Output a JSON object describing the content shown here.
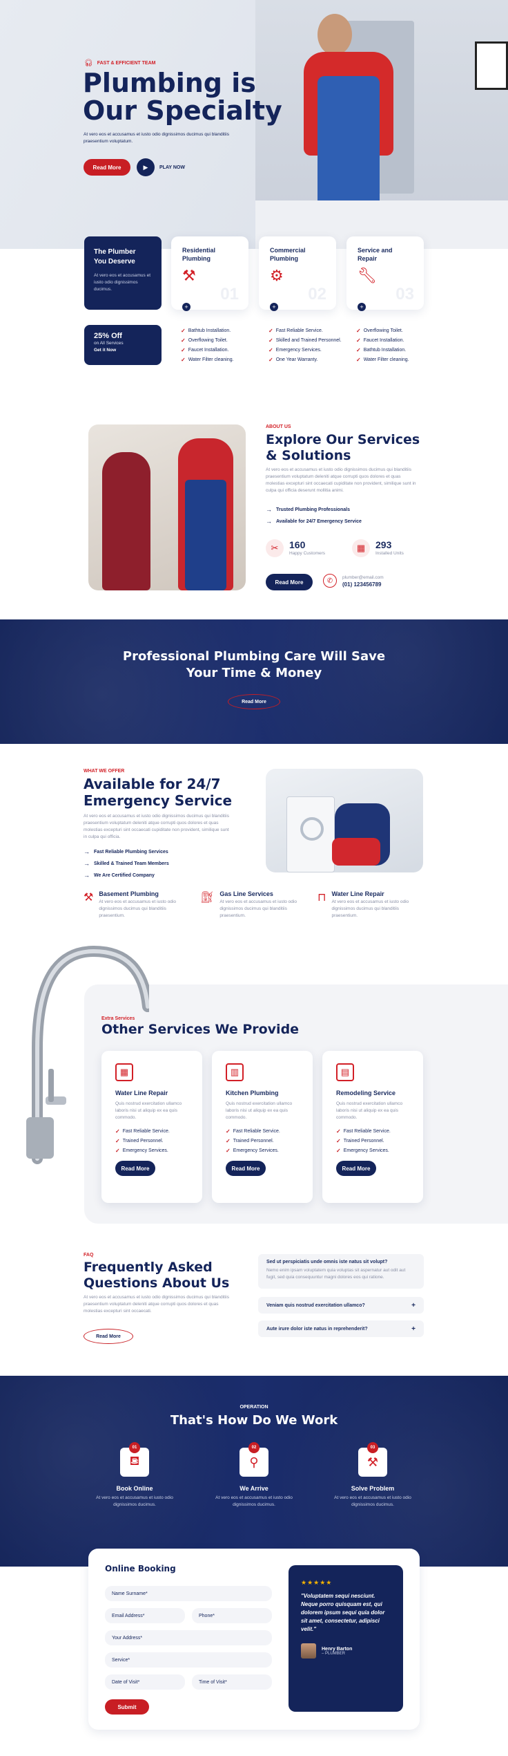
{
  "hero": {
    "tag": "FAST & EFFICIENT TEAM",
    "title_line1": "Plumbing is",
    "title_line2": "Our Specialty",
    "text": "At vero eos et accusamus et iusto odio dignissimos ducimus qui blanditiis praesentium voluptatum.",
    "read_more": "Read More",
    "play_now": "PLAY NOW"
  },
  "feature": {
    "title": "The Plumber You Deserve",
    "text": "At vero eos et accusamus et iusto odio dignissimos ducimus.",
    "promo_title": "25% Off",
    "promo_sub": "on All Services",
    "promo_cta": "Get it Now"
  },
  "service_cards": [
    {
      "title": "Residential Plumbing",
      "num": "01",
      "items": [
        "Bathtub Installation.",
        "Overflowing Toilet.",
        "Faucet Installation.",
        "Water Filter cleaning."
      ]
    },
    {
      "title": "Commercial Plumbing",
      "num": "02",
      "items": [
        "Fast Reliable Service.",
        "Skilled and Trained Personnel.",
        "Emergency Services.",
        "One Year Warranty."
      ]
    },
    {
      "title": "Service and Repair",
      "num": "03",
      "items": [
        "Overflowing Toilet.",
        "Faucet Installation.",
        "Bathtub Installation.",
        "Water Filter cleaning."
      ]
    }
  ],
  "about": {
    "tag": "ABOUT US",
    "title": "Explore Our Services & Solutions",
    "text": "At vero eos et accusamus et iusto odio dignissimos ducimus qui blanditiis praesentium voluptatum deleniti atque corrupti quos dolores et quas molestias excepturi sint occaecati cupiditate non provident, similique sunt in culpa qui officia deserunt mollitia animi.",
    "points": [
      "Trusted Plumbing Professionals",
      "Available for 24/7 Emergency Service"
    ],
    "stat1_value": "160",
    "stat1_label": "Happy Customers",
    "stat2_value": "293",
    "stat2_label": "Installed Units",
    "read_more": "Read More",
    "email": "plumber@email.com",
    "phone": "(01) 123456789"
  },
  "banner": {
    "title_line1": "Professional Plumbing Care Will Save",
    "title_line2": "Your Time & Money",
    "read_more": "Read More"
  },
  "offer": {
    "tag": "WHAT WE OFFER",
    "title_line1": "Available for 24/7",
    "title_line2": "Emergency Service",
    "text": "At vero eos et accusamus et iusto odio dignissimos ducimus qui blanditiis praesentium voluptatum deleniti atque corrupti quos dolores et quas molestias excepturi sint occaecati cupiditate non provident, similique sunt in culpa qui officia.",
    "points": [
      "Fast Reliable Plumbing Services",
      "Skilled & Trained Team Members",
      "We Are Certified Company"
    ],
    "services": [
      {
        "title": "Basement Plumbing",
        "text": "At vero eos et accusamus et iusto odio dignissimos ducimus qui blanditiis praesentium."
      },
      {
        "title": "Gas Line Services",
        "text": "At vero eos et accusamus et iusto odio dignissimos ducimus qui blanditiis praesentium."
      },
      {
        "title": "Water Line Repair",
        "text": "At vero eos et accusamus et iusto odio dignissimos ducimus qui blanditiis praesentium."
      }
    ]
  },
  "extra": {
    "tag": "Extra Services",
    "title": "Other Services We Provide",
    "cards": [
      {
        "title": "Water Line Repair",
        "text": "Quis nostrud exercitation ullamco laboris nisi ut aliquip ex ea quis commodo.",
        "items": [
          "Fast Reliable Service.",
          "Trained Personnel.",
          "Emergency Services."
        ],
        "btn": "Read More"
      },
      {
        "title": "Kitchen Plumbing",
        "text": "Quis nostrud exercitation ullamco laboris nisi ut aliquip ex ea quis commodo.",
        "items": [
          "Fast Reliable Service.",
          "Trained Personnel.",
          "Emergency Services."
        ],
        "btn": "Read More"
      },
      {
        "title": "Remodeling Service",
        "text": "Quis nostrud exercitation ullamco laboris nisi ut aliquip ex ea quis commodo.",
        "items": [
          "Fast Reliable Service.",
          "Trained Personnel.",
          "Emergency Services."
        ],
        "btn": "Read More"
      }
    ]
  },
  "faq": {
    "tag": "FAQ",
    "title_line1": "Frequently Asked",
    "title_line2": "Questions About Us",
    "text": "At vero eos et accusamus et iusto odio dignissimos ducimus qui blanditiis praesentium voluptatum deleniti atque corrupti quos dolores et quas molestias excepturi sint occaecati.",
    "read_more": "Read More",
    "items": [
      {
        "q": "Sed ut perspiciatis unde omnis iste natus sit volupt?",
        "a": "Nemo enim ipsam voluptatem quia voluptas sit aspernatur aut odit aut fugit, sed quia consequuntur magni dolores eos qui ratione."
      },
      {
        "q": "Veniam quis nostrud exercitation ullamco?",
        "a": ""
      },
      {
        "q": "Aute irure dolor iste natus in reprehenderit?",
        "a": ""
      }
    ]
  },
  "process": {
    "tag": "OPERATION",
    "title": "That's How Do We Work",
    "steps": [
      {
        "num": "01",
        "title": "Book Online",
        "text": "At vero eos et accusamus et iusto odio dignissimos ducimus."
      },
      {
        "num": "02",
        "title": "We Arrive",
        "text": "At vero eos et accusamus et iusto odio dignissimos ducimus."
      },
      {
        "num": "03",
        "title": "Solve Problem",
        "text": "At vero eos et accusamus et iusto odio dignissimos ducimus."
      }
    ]
  },
  "booking": {
    "title": "Online Booking",
    "fields": {
      "name": "Name Surname*",
      "email": "Email Address*",
      "phone": "Phone*",
      "address": "Your Address*",
      "service": "Service*",
      "date": "Date of Visit*",
      "time": "Time of Visit*"
    },
    "submit": "Submit",
    "stars": "★★★★★",
    "quote": "\"Voluptatem sequi nesciunt. Neque porro quisquam est, qui dolorem ipsum sequi quia dolor sit amet, consectetur, adipisci velit.\"",
    "author": "Henry Barton",
    "role": "– PLUMBER"
  }
}
